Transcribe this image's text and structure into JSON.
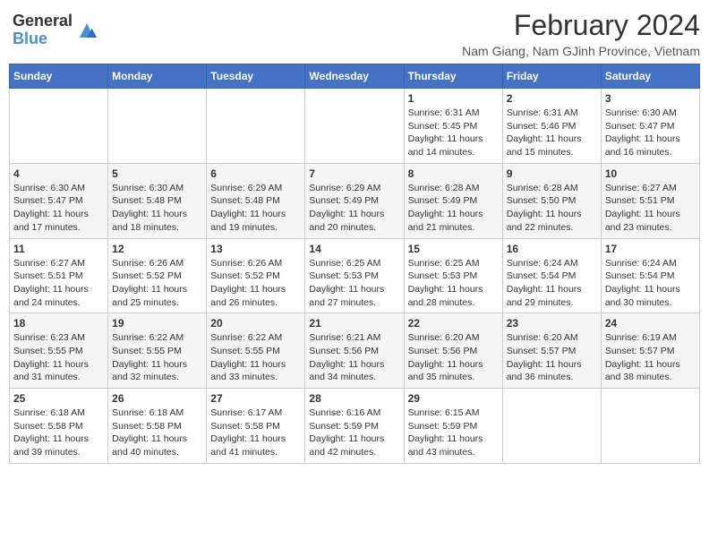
{
  "header": {
    "logo_line1": "General",
    "logo_line2": "Blue",
    "month_title": "February 2024",
    "location": "Nam Giang, Nam GJinh Province, Vietnam"
  },
  "weekdays": [
    "Sunday",
    "Monday",
    "Tuesday",
    "Wednesday",
    "Thursday",
    "Friday",
    "Saturday"
  ],
  "weeks": [
    [
      {
        "day": "",
        "info": ""
      },
      {
        "day": "",
        "info": ""
      },
      {
        "day": "",
        "info": ""
      },
      {
        "day": "",
        "info": ""
      },
      {
        "day": "1",
        "info": "Sunrise: 6:31 AM\nSunset: 5:45 PM\nDaylight: 11 hours and 14 minutes."
      },
      {
        "day": "2",
        "info": "Sunrise: 6:31 AM\nSunset: 5:46 PM\nDaylight: 11 hours and 15 minutes."
      },
      {
        "day": "3",
        "info": "Sunrise: 6:30 AM\nSunset: 5:47 PM\nDaylight: 11 hours and 16 minutes."
      }
    ],
    [
      {
        "day": "4",
        "info": "Sunrise: 6:30 AM\nSunset: 5:47 PM\nDaylight: 11 hours and 17 minutes."
      },
      {
        "day": "5",
        "info": "Sunrise: 6:30 AM\nSunset: 5:48 PM\nDaylight: 11 hours and 18 minutes."
      },
      {
        "day": "6",
        "info": "Sunrise: 6:29 AM\nSunset: 5:48 PM\nDaylight: 11 hours and 19 minutes."
      },
      {
        "day": "7",
        "info": "Sunrise: 6:29 AM\nSunset: 5:49 PM\nDaylight: 11 hours and 20 minutes."
      },
      {
        "day": "8",
        "info": "Sunrise: 6:28 AM\nSunset: 5:49 PM\nDaylight: 11 hours and 21 minutes."
      },
      {
        "day": "9",
        "info": "Sunrise: 6:28 AM\nSunset: 5:50 PM\nDaylight: 11 hours and 22 minutes."
      },
      {
        "day": "10",
        "info": "Sunrise: 6:27 AM\nSunset: 5:51 PM\nDaylight: 11 hours and 23 minutes."
      }
    ],
    [
      {
        "day": "11",
        "info": "Sunrise: 6:27 AM\nSunset: 5:51 PM\nDaylight: 11 hours and 24 minutes."
      },
      {
        "day": "12",
        "info": "Sunrise: 6:26 AM\nSunset: 5:52 PM\nDaylight: 11 hours and 25 minutes."
      },
      {
        "day": "13",
        "info": "Sunrise: 6:26 AM\nSunset: 5:52 PM\nDaylight: 11 hours and 26 minutes."
      },
      {
        "day": "14",
        "info": "Sunrise: 6:25 AM\nSunset: 5:53 PM\nDaylight: 11 hours and 27 minutes."
      },
      {
        "day": "15",
        "info": "Sunrise: 6:25 AM\nSunset: 5:53 PM\nDaylight: 11 hours and 28 minutes."
      },
      {
        "day": "16",
        "info": "Sunrise: 6:24 AM\nSunset: 5:54 PM\nDaylight: 11 hours and 29 minutes."
      },
      {
        "day": "17",
        "info": "Sunrise: 6:24 AM\nSunset: 5:54 PM\nDaylight: 11 hours and 30 minutes."
      }
    ],
    [
      {
        "day": "18",
        "info": "Sunrise: 6:23 AM\nSunset: 5:55 PM\nDaylight: 11 hours and 31 minutes."
      },
      {
        "day": "19",
        "info": "Sunrise: 6:22 AM\nSunset: 5:55 PM\nDaylight: 11 hours and 32 minutes."
      },
      {
        "day": "20",
        "info": "Sunrise: 6:22 AM\nSunset: 5:55 PM\nDaylight: 11 hours and 33 minutes."
      },
      {
        "day": "21",
        "info": "Sunrise: 6:21 AM\nSunset: 5:56 PM\nDaylight: 11 hours and 34 minutes."
      },
      {
        "day": "22",
        "info": "Sunrise: 6:20 AM\nSunset: 5:56 PM\nDaylight: 11 hours and 35 minutes."
      },
      {
        "day": "23",
        "info": "Sunrise: 6:20 AM\nSunset: 5:57 PM\nDaylight: 11 hours and 36 minutes."
      },
      {
        "day": "24",
        "info": "Sunrise: 6:19 AM\nSunset: 5:57 PM\nDaylight: 11 hours and 38 minutes."
      }
    ],
    [
      {
        "day": "25",
        "info": "Sunrise: 6:18 AM\nSunset: 5:58 PM\nDaylight: 11 hours and 39 minutes."
      },
      {
        "day": "26",
        "info": "Sunrise: 6:18 AM\nSunset: 5:58 PM\nDaylight: 11 hours and 40 minutes."
      },
      {
        "day": "27",
        "info": "Sunrise: 6:17 AM\nSunset: 5:58 PM\nDaylight: 11 hours and 41 minutes."
      },
      {
        "day": "28",
        "info": "Sunrise: 6:16 AM\nSunset: 5:59 PM\nDaylight: 11 hours and 42 minutes."
      },
      {
        "day": "29",
        "info": "Sunrise: 6:15 AM\nSunset: 5:59 PM\nDaylight: 11 hours and 43 minutes."
      },
      {
        "day": "",
        "info": ""
      },
      {
        "day": "",
        "info": ""
      }
    ]
  ]
}
